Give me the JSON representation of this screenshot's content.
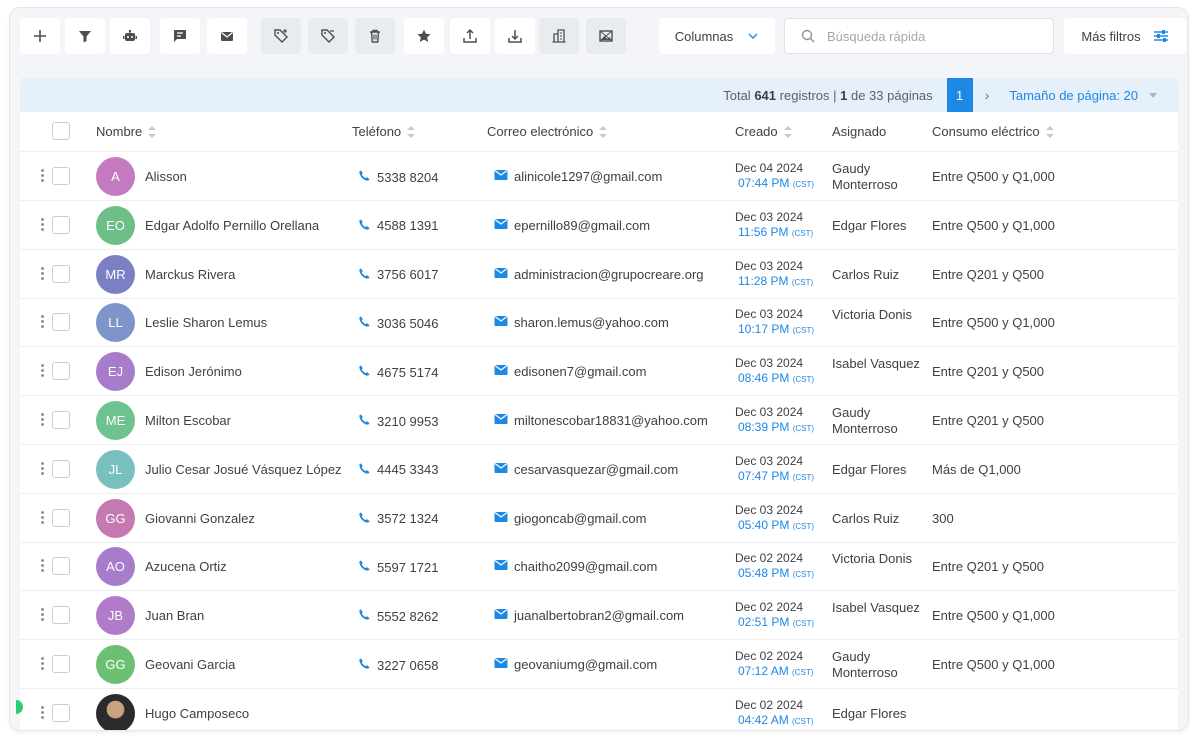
{
  "toolbar": {
    "buttons": [
      {
        "icon": "plus-icon"
      },
      {
        "icon": "filter-icon"
      },
      {
        "icon": "robot-icon"
      },
      {
        "icon": "chat-icon"
      },
      {
        "icon": "mail-icon"
      },
      {
        "icon": "tag-add-icon"
      },
      {
        "icon": "tag-remove-icon"
      },
      {
        "icon": "trash-icon"
      },
      {
        "icon": "star-icon"
      },
      {
        "icon": "upload-icon"
      },
      {
        "icon": "download-icon"
      },
      {
        "icon": "building-icon"
      },
      {
        "icon": "image-icon"
      }
    ],
    "columns_label": "Columnas",
    "search_placeholder": "Búsqueda rápida",
    "more_filters_label": "Más filtros"
  },
  "pager": {
    "total_prefix": "Total",
    "total": "641",
    "records_label": "registros |",
    "current": "1",
    "of_label": "de 33 páginas",
    "active_page": "1",
    "page_size_label": "Tamaño de página: 20"
  },
  "columns": {
    "name": "Nombre",
    "phone": "Teléfono",
    "email": "Correo electrónico",
    "created": "Creado",
    "assigned": "Asignado",
    "consumption": "Consumo eléctrico"
  },
  "colors": {
    "accent": "#1e88e5"
  },
  "rows": [
    {
      "initials": "A",
      "avatar_color": "#c47ac0",
      "name": "Alisson",
      "phone": "5338 8204",
      "email": "alinicole1297@gmail.com",
      "date": "Dec 04 2024",
      "time": "07:44 PM",
      "tz": "(CST)",
      "assigned": "Gaudy Monterroso",
      "consumo": "Entre Q500 y Q1,000"
    },
    {
      "initials": "EO",
      "avatar_color": "#6dbf87",
      "name": "Edgar Adolfo Pernillo Orellana",
      "phone": "4588 1391",
      "email": "epernillo89@gmail.com",
      "date": "Dec 03 2024",
      "time": "11:56 PM",
      "tz": "(CST)",
      "assigned": "Edgar Flores",
      "consumo": "Entre Q500 y Q1,000"
    },
    {
      "initials": "MR",
      "avatar_color": "#7b7fc4",
      "name": "Marckus Rivera",
      "phone": "3756 6017",
      "email": "administracion@grupocreare.org",
      "date": "Dec 03 2024",
      "time": "11:28 PM",
      "tz": "(CST)",
      "assigned": "Carlos Ruiz",
      "consumo": "Entre Q201 y Q500"
    },
    {
      "initials": "LL",
      "avatar_color": "#7d95c9",
      "name": "Leslie Sharon Lemus",
      "phone": "3036 5046",
      "email": "sharon.lemus@yahoo.com",
      "date": "Dec 03 2024",
      "time": "10:17 PM",
      "tz": "(CST)",
      "assigned": "Victoria Donis",
      "consumo": "Entre Q500 y Q1,000"
    },
    {
      "initials": "EJ",
      "avatar_color": "#a77ccb",
      "name": "Edison Jerónimo",
      "phone": "4675 5174",
      "email": "edisonen7@gmail.com",
      "date": "Dec 03 2024",
      "time": "08:46 PM",
      "tz": "(CST)",
      "assigned": "Isabel Vasquez",
      "consumo": "Entre Q201 y Q500"
    },
    {
      "initials": "ME",
      "avatar_color": "#6dc28f",
      "name": "Milton Escobar",
      "phone": "3210 9953",
      "email": "miltonescobar18831@yahoo.com",
      "date": "Dec 03 2024",
      "time": "08:39 PM",
      "tz": "(CST)",
      "assigned": "Gaudy Monterroso",
      "consumo": "Entre Q201 y Q500"
    },
    {
      "initials": "JL",
      "avatar_color": "#78c0bd",
      "name": "Julio Cesar Josué Vásquez López",
      "phone": "4445 3343",
      "email": "cesarvasquezar@gmail.com",
      "date": "Dec 03 2024",
      "time": "07:47 PM",
      "tz": "(CST)",
      "assigned": "Edgar Flores",
      "consumo": "Más de Q1,000"
    },
    {
      "initials": "GG",
      "avatar_color": "#c479b0",
      "name": "Giovanni Gonzalez",
      "phone": "3572 1324",
      "email": "giogoncab@gmail.com",
      "date": "Dec 03 2024",
      "time": "05:40 PM",
      "tz": "(CST)",
      "assigned": "Carlos Ruiz",
      "consumo": "300"
    },
    {
      "initials": "AO",
      "avatar_color": "#a77ccb",
      "name": "Azucena Ortiz",
      "phone": "5597 1721",
      "email": "chaitho2099@gmail.com",
      "date": "Dec 02 2024",
      "time": "05:48 PM",
      "tz": "(CST)",
      "assigned": "Victoria Donis",
      "consumo": "Entre Q201 y Q500"
    },
    {
      "initials": "JB",
      "avatar_color": "#b07cc9",
      "name": "Juan Bran",
      "phone": "5552 8262",
      "email": "juanalbertobran2@gmail.com",
      "date": "Dec 02 2024",
      "time": "02:51 PM",
      "tz": "(CST)",
      "assigned": "Isabel Vasquez",
      "consumo": "Entre Q500 y Q1,000"
    },
    {
      "initials": "GG",
      "avatar_color": "#6dbf73",
      "name": "Geovani Garcia",
      "phone": "3227 0658",
      "email": "geovaniumg@gmail.com",
      "date": "Dec 02 2024",
      "time": "07:12 AM",
      "tz": "(CST)",
      "assigned": "Gaudy Monterroso",
      "consumo": "Entre Q500 y Q1,000"
    },
    {
      "initials": "",
      "avatar_color": "",
      "photo": true,
      "name": "Hugo Camposeco",
      "phone": "",
      "email": "",
      "date": "Dec 02 2024",
      "time": "04:42 AM",
      "tz": "(CST)",
      "assigned": "Edgar Flores",
      "consumo": ""
    }
  ]
}
